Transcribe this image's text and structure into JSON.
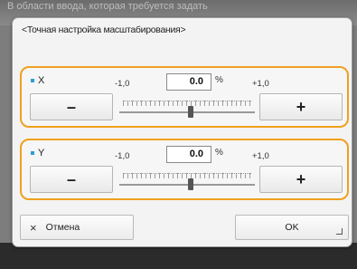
{
  "background": {
    "hint_text": "В области ввода, которая требуется задать"
  },
  "dialog": {
    "title": "<Точная настройка масштабирования>"
  },
  "x_group": {
    "axis_label": "X",
    "min_label": "-1,0",
    "max_label": "+1,0",
    "value": "0.0",
    "unit": "%",
    "minus_label": "–",
    "plus_label": "+",
    "slider_level": 0.5
  },
  "y_group": {
    "axis_label": "Y",
    "min_label": "-1,0",
    "max_label": "+1,0",
    "value": "0.0",
    "unit": "%",
    "minus_label": "–",
    "plus_label": "+",
    "slider_level": 0.5
  },
  "footer": {
    "cancel_icon": "×",
    "cancel_label": "Отмена",
    "ok_label": "OK"
  },
  "colors": {
    "accent_border": "#f0a020",
    "bullet": "#2a9fd6"
  }
}
